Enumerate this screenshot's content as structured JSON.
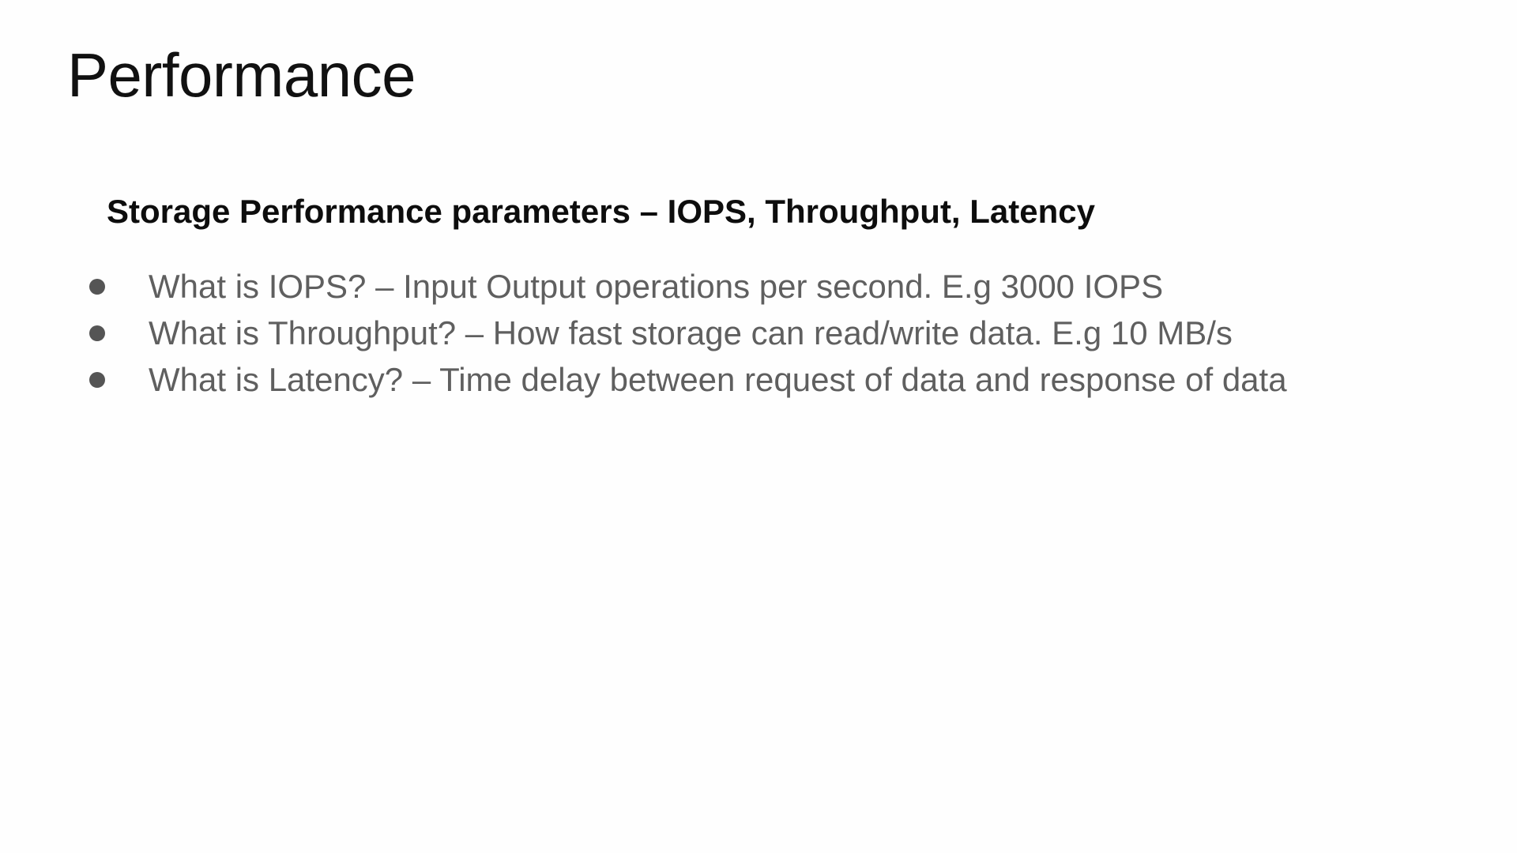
{
  "slide": {
    "title": "Performance",
    "subtitle": "Storage Performance parameters – IOPS, Throughput, Latency",
    "bullets": [
      "What is IOPS? – Input Output operations per second. E.g 3000 IOPS",
      "What is Throughput? – How fast storage can read/write data. E.g 10 MB/s",
      "What is Latency? – Time delay between request of data and response of data"
    ]
  }
}
